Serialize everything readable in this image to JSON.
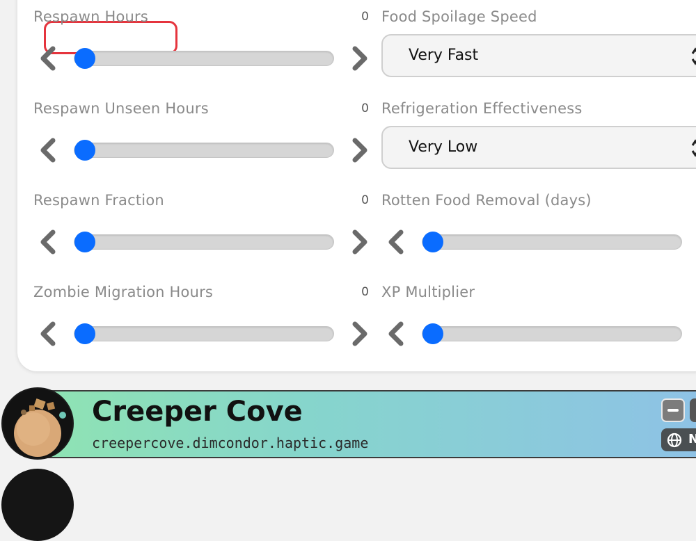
{
  "settings": {
    "left": [
      {
        "label": "Respawn Hours",
        "value": "0",
        "slider": 0
      },
      {
        "label": "Respawn Unseen Hours",
        "value": "0",
        "slider": 0
      },
      {
        "label": "Respawn Fraction",
        "value": "0",
        "slider": 0
      },
      {
        "label": "Zombie Migration Hours",
        "value": "0",
        "slider": 0
      }
    ],
    "right": {
      "food_spoilage": {
        "label": "Food Spoilage Speed",
        "selected": "Very Fast"
      },
      "refrigeration": {
        "label": "Refrigeration Effectiveness",
        "selected": "Very Low"
      },
      "rotten_removal": {
        "label": "Rotten Food Removal (days)",
        "slider": 0
      },
      "xp_multiplier": {
        "label": "XP Multiplier",
        "slider": 0
      }
    }
  },
  "server": {
    "name": "Creeper Cove",
    "host": "creepercove.dimcondor.haptic.game",
    "badge": "N"
  },
  "colors": {
    "accent": "#0a6cff",
    "highlight": "#e5343d",
    "track": "#d6d6d6"
  },
  "icons": {
    "decrement": "chevron-left-icon",
    "increment": "chevron-right-icon",
    "select": "select-updown-icon",
    "collapse": "minus-icon",
    "badge": "globe-icon"
  }
}
